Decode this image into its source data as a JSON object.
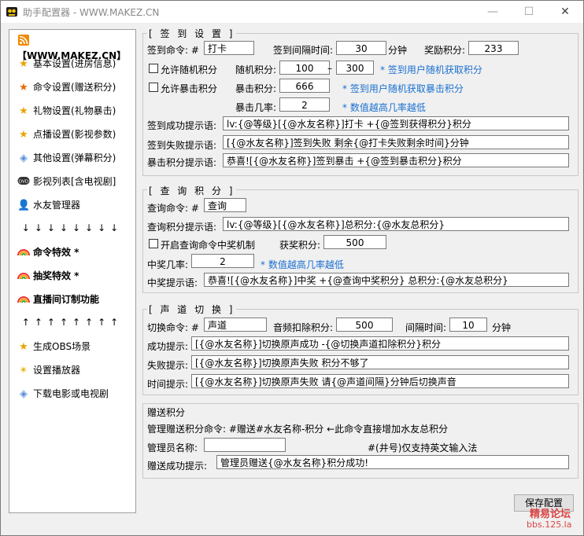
{
  "window": {
    "title": "助手配置器 - WWW.MAKEZ.CN",
    "minimize": "—",
    "maximize": "☐",
    "close": "✕"
  },
  "sidebar": {
    "header": "【WWW.MAKEZ.CN】",
    "items": [
      {
        "label": "基本设置(进房信息)",
        "icon": "star-icon"
      },
      {
        "label": "命令设置(赠送积分)",
        "icon": "star-icon"
      },
      {
        "label": "礼物设置(礼物暴击)",
        "icon": "star-icon"
      },
      {
        "label": "点播设置(影视参数)",
        "icon": "star-icon"
      },
      {
        "label": "其他设置(弹幕积分)",
        "icon": "tag-icon"
      },
      {
        "label": "影视列表[含电视剧]",
        "icon": "dvd-icon"
      },
      {
        "label": "水友管理器",
        "icon": "user-icon"
      }
    ],
    "arrows_down": "↓↓↓↓↓↓↓↓",
    "specials": [
      {
        "label": "命令特效 *",
        "icon": "rainbow-icon"
      },
      {
        "label": "抽奖特效 *",
        "icon": "rainbow-icon"
      },
      {
        "label": "直播间订制功能",
        "icon": "rainbow-icon"
      }
    ],
    "arrows_up": "↑↑↑↑↑↑↑↑",
    "bottom_items": [
      {
        "label": "生成OBS场景",
        "icon": "star-icon"
      },
      {
        "label": "设置播放器",
        "icon": "sparkle-icon"
      },
      {
        "label": "下载电影或电视剧",
        "icon": "tag-icon"
      }
    ]
  },
  "signin": {
    "title": "[ 签 到 设 置 ]",
    "command_label": "签到命令: #",
    "command_value": "打卡",
    "interval_label": "签到间隔时间:",
    "interval_value": "30",
    "interval_unit": "分钟",
    "reward_label": "奖励积分:",
    "reward_value": "233",
    "random_checkbox": "允许随机积分",
    "random_label": "随机积分:",
    "random_min": "100",
    "random_dash": "–",
    "random_max": "300",
    "random_hint": "* 签到用户随机获取积分",
    "crit_checkbox": "允许暴击积分",
    "crit_label": "暴击积分:",
    "crit_value": "666",
    "crit_hint": "* 签到用户随机获取暴击积分",
    "crit_rate_label": "暴击几率:",
    "crit_rate_value": "2",
    "crit_rate_hint": "* 数值越高几率越低",
    "success_label": "签到成功提示语:",
    "success_value": "lv:{@等级}[{@水友名称}]打卡 +{@签到获得积分}积分",
    "fail_label": "签到失败提示语:",
    "fail_value": "[{@水友名称}]签到失败 剩余{@打卡失败剩余时间}分钟",
    "crit_msg_label": "暴击积分提示语:",
    "crit_msg_value": "恭喜![{@水友名称}]签到暴击 +{@签到暴击积分}积分"
  },
  "query": {
    "title": "[ 查 询 积 分 ]",
    "command_label": "查询命令: #",
    "command_value": "查询",
    "msg_label": "查询积分提示语:",
    "msg_value": "lv:{@等级}[{@水友名称}]总积分:{@水友总积分}",
    "lottery_checkbox": "开启查询命令中奖机制",
    "prize_label": "获奖积分:",
    "prize_value": "500",
    "rate_label": "中奖几率:",
    "rate_value": "2",
    "rate_hint": "* 数值越高几率越低",
    "win_label": "中奖提示语:",
    "win_value": "恭喜![{@水友名称}]中奖 +{@查询中奖积分} 总积分:{@水友总积分}"
  },
  "voice": {
    "title": "[ 声 道 切 换 ]",
    "command_label": "切换命令: #",
    "command_value": "声道",
    "cost_label": "音频扣除积分:",
    "cost_value": "500",
    "interval_label": "间隔时间:",
    "interval_value": "10",
    "interval_unit": "分钟",
    "success_label": "成功提示:",
    "success_value": "[{@水友名称}]切换原声成功 -{@切换声道扣除积分}积分",
    "fail_label": "失败提示:",
    "fail_value": "[{@水友名称}]切换原声失败 积分不够了",
    "time_label": "时间提示:",
    "time_value": "[{@水友名称}]切换原声失败 请{@声道间隔}分钟后切换声音"
  },
  "gift": {
    "title": "赠送积分",
    "command_line": "管理赠送积分命令: #赠送#水友名称-积分  ←此命令直接增加水友总积分",
    "admin_label": "管理员名称:",
    "admin_value": "",
    "admin_hint": "#(井号)仅支持英文输入法",
    "success_label": "赠送成功提示:",
    "success_value": "管理员赠送{@水友名称}积分成功!"
  },
  "footer": {
    "save": "保存配置",
    "watermark1": "精易论坛",
    "watermark2": "bbs.125.la"
  }
}
